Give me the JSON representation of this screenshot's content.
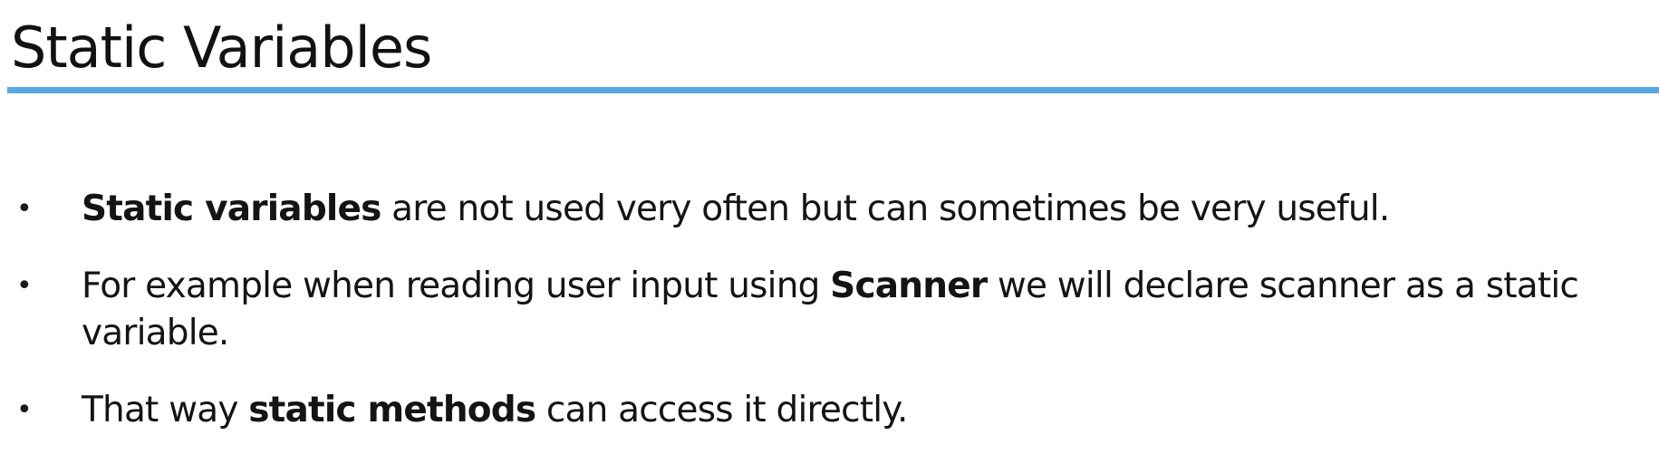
{
  "slide": {
    "title": "Static Variables",
    "accent_color": "#5aa7e6",
    "bullet_glyph": "•",
    "bullets": [
      {
        "bold_lead": "Static variables",
        "text_after": " are not used very often but can sometimes be very useful."
      },
      {
        "text_before": "For example when reading user input using ",
        "bold": "Scanner",
        "text_after": " we will declare scanner as a static variable."
      },
      {
        "text_before": "That way ",
        "bold": "static methods",
        "text_after": " can access it directly."
      }
    ]
  }
}
